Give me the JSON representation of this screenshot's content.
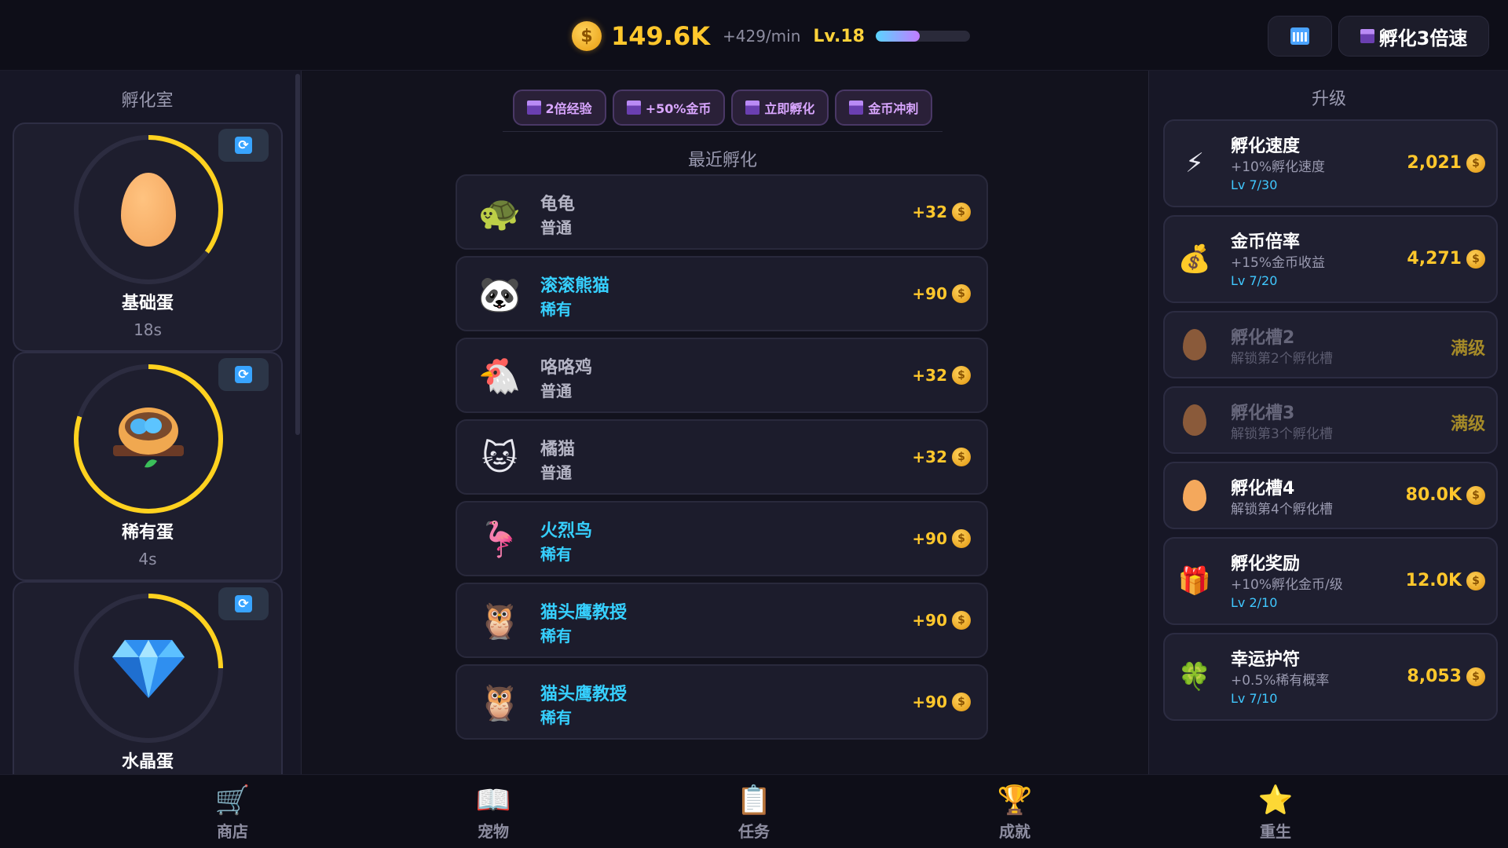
{
  "top": {
    "coin_symbol": "$",
    "gold": "149.6K",
    "rate": "+429/min",
    "level": "Lv.18",
    "xp_fraction": 0.47,
    "speed_button": "孵化3倍速"
  },
  "left": {
    "title": "孵化室",
    "incubators": [
      {
        "name": "基础蛋",
        "time": "18s",
        "progress": 0.35,
        "icon": "orange-egg-icon"
      },
      {
        "name": "稀有蛋",
        "time": "4s",
        "progress": 0.8,
        "icon": "nest-icon"
      },
      {
        "name": "水晶蛋",
        "time": "",
        "progress": 0.25,
        "icon": "diamond-icon"
      }
    ]
  },
  "boosts": [
    "2倍经验",
    "+50%金币",
    "立即孵化",
    "金币冲刺"
  ],
  "recent": {
    "title": "最近孵化",
    "items": [
      {
        "name": "龟龟",
        "rarity": "普通",
        "gain": "+32",
        "icon": "🐢"
      },
      {
        "name": "滚滚熊猫",
        "rarity": "稀有",
        "gain": "+90",
        "icon": "🐼"
      },
      {
        "name": "咯咯鸡",
        "rarity": "普通",
        "gain": "+32",
        "icon": "🐔"
      },
      {
        "name": "橘猫",
        "rarity": "普通",
        "gain": "+32",
        "icon": "🐱"
      },
      {
        "name": "火烈鸟",
        "rarity": "稀有",
        "gain": "+90",
        "icon": "🦩"
      },
      {
        "name": "猫头鹰教授",
        "rarity": "稀有",
        "gain": "+90",
        "icon": "🦉"
      },
      {
        "name": "猫头鹰教授",
        "rarity": "稀有",
        "gain": "+90",
        "icon": "🦉"
      }
    ]
  },
  "upgrades": {
    "title": "升级",
    "items": [
      {
        "name": "孵化速度",
        "desc": "+10%孵化速度",
        "lv": "Lv 7/30",
        "cost": "2,021",
        "icon": "⚡"
      },
      {
        "name": "金币倍率",
        "desc": "+15%金币收益",
        "lv": "Lv 7/20",
        "cost": "4,271",
        "icon": "💰"
      },
      {
        "name": "孵化槽2",
        "desc": "解锁第2个孵化槽",
        "cost": "满级",
        "icon": "brown-egg"
      },
      {
        "name": "孵化槽3",
        "desc": "解锁第3个孵化槽",
        "cost": "满级",
        "icon": "brown-egg"
      },
      {
        "name": "孵化槽4",
        "desc": "解锁第4个孵化槽",
        "cost": "80.0K",
        "icon": "orange-egg"
      },
      {
        "name": "孵化奖励",
        "desc": "+10%孵化金币/级",
        "lv": "Lv 2/10",
        "cost": "12.0K",
        "icon": "🎁"
      },
      {
        "name": "幸运护符",
        "desc": "+0.5%稀有概率",
        "lv": "Lv 7/10",
        "cost": "8,053",
        "icon": "🍀"
      }
    ]
  },
  "nav": [
    {
      "label": "商店",
      "icon": "🛒"
    },
    {
      "label": "宠物",
      "icon": "📖"
    },
    {
      "label": "任务",
      "icon": "📋"
    },
    {
      "label": "成就",
      "icon": "🏆"
    },
    {
      "label": "重生",
      "icon": "⭐"
    }
  ]
}
